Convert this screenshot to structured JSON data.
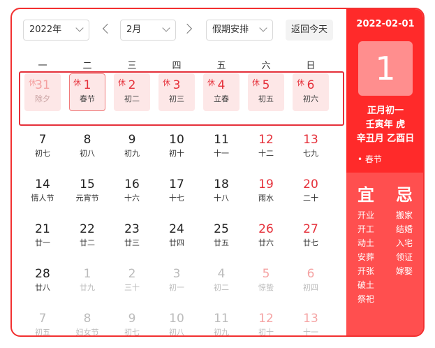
{
  "toolbar": {
    "year_select": "2022年",
    "month_select": "2月",
    "holiday_select": "假期安排",
    "today_button": "返回今天"
  },
  "weekdays": [
    "一",
    "二",
    "三",
    "四",
    "五",
    "六",
    "日"
  ],
  "holiday_tag": "休",
  "calendar": [
    [
      {
        "day": "31",
        "lunar": "除夕",
        "other": true,
        "weekend": false,
        "holiday": true
      },
      {
        "day": "1",
        "lunar": "春节",
        "other": false,
        "weekend": false,
        "holiday": true,
        "selected": true
      },
      {
        "day": "2",
        "lunar": "初二",
        "other": false,
        "weekend": false,
        "holiday": true
      },
      {
        "day": "3",
        "lunar": "初三",
        "other": false,
        "weekend": false,
        "holiday": true
      },
      {
        "day": "4",
        "lunar": "立春",
        "other": false,
        "weekend": false,
        "holiday": true
      },
      {
        "day": "5",
        "lunar": "初五",
        "other": false,
        "weekend": true,
        "holiday": true
      },
      {
        "day": "6",
        "lunar": "初六",
        "other": false,
        "weekend": true,
        "holiday": true
      }
    ],
    [
      {
        "day": "7",
        "lunar": "初七"
      },
      {
        "day": "8",
        "lunar": "初八"
      },
      {
        "day": "9",
        "lunar": "初九"
      },
      {
        "day": "10",
        "lunar": "初十"
      },
      {
        "day": "11",
        "lunar": "十一"
      },
      {
        "day": "12",
        "lunar": "十二",
        "weekend": true
      },
      {
        "day": "13",
        "lunar": "七九",
        "weekend": true
      }
    ],
    [
      {
        "day": "14",
        "lunar": "情人节"
      },
      {
        "day": "15",
        "lunar": "元宵节"
      },
      {
        "day": "16",
        "lunar": "十六"
      },
      {
        "day": "17",
        "lunar": "十七"
      },
      {
        "day": "18",
        "lunar": "十八"
      },
      {
        "day": "19",
        "lunar": "雨水",
        "weekend": true
      },
      {
        "day": "20",
        "lunar": "二十",
        "weekend": true
      }
    ],
    [
      {
        "day": "21",
        "lunar": "廿一"
      },
      {
        "day": "22",
        "lunar": "廿二"
      },
      {
        "day": "23",
        "lunar": "廿三"
      },
      {
        "day": "24",
        "lunar": "廿四"
      },
      {
        "day": "25",
        "lunar": "廿五"
      },
      {
        "day": "26",
        "lunar": "廿六",
        "weekend": true
      },
      {
        "day": "27",
        "lunar": "廿七",
        "weekend": true
      }
    ],
    [
      {
        "day": "28",
        "lunar": "廿八"
      },
      {
        "day": "1",
        "lunar": "廿九",
        "other": true
      },
      {
        "day": "2",
        "lunar": "三十",
        "other": true
      },
      {
        "day": "3",
        "lunar": "初一",
        "other": true
      },
      {
        "day": "4",
        "lunar": "初二",
        "other": true
      },
      {
        "day": "5",
        "lunar": "惊蛰",
        "other": true,
        "weekend": true
      },
      {
        "day": "6",
        "lunar": "初四",
        "other": true,
        "weekend": true
      }
    ],
    [
      {
        "day": "7",
        "lunar": "初五",
        "other": true
      },
      {
        "day": "8",
        "lunar": "妇女节",
        "other": true
      },
      {
        "day": "9",
        "lunar": "初七",
        "other": true
      },
      {
        "day": "10",
        "lunar": "初八",
        "other": true
      },
      {
        "day": "11",
        "lunar": "初九",
        "other": true
      },
      {
        "day": "12",
        "lunar": "初十",
        "other": true,
        "weekend": true
      },
      {
        "day": "13",
        "lunar": "十一",
        "other": true,
        "weekend": true
      }
    ]
  ],
  "side": {
    "date": "2022-02-01",
    "big_day": "1",
    "lunar_date": "正月初一",
    "year_ganzhi": "壬寅年 虎",
    "month_day_ganzhi": "辛丑月 乙酉日",
    "festival": "• 春节",
    "yi_title": "宜",
    "ji_title": "忌",
    "yi": [
      "开业",
      "开工",
      "动土",
      "安葬",
      "开张",
      "破土",
      "祭祀"
    ],
    "ji": [
      "搬家",
      "结婚",
      "入宅",
      "领证",
      "嫁娶"
    ]
  },
  "colors": {
    "accent": "#f23030",
    "panel": "#ff2a2a",
    "panel_lower": "#ff4f4f",
    "holiday_bg": "#fde7e7"
  }
}
